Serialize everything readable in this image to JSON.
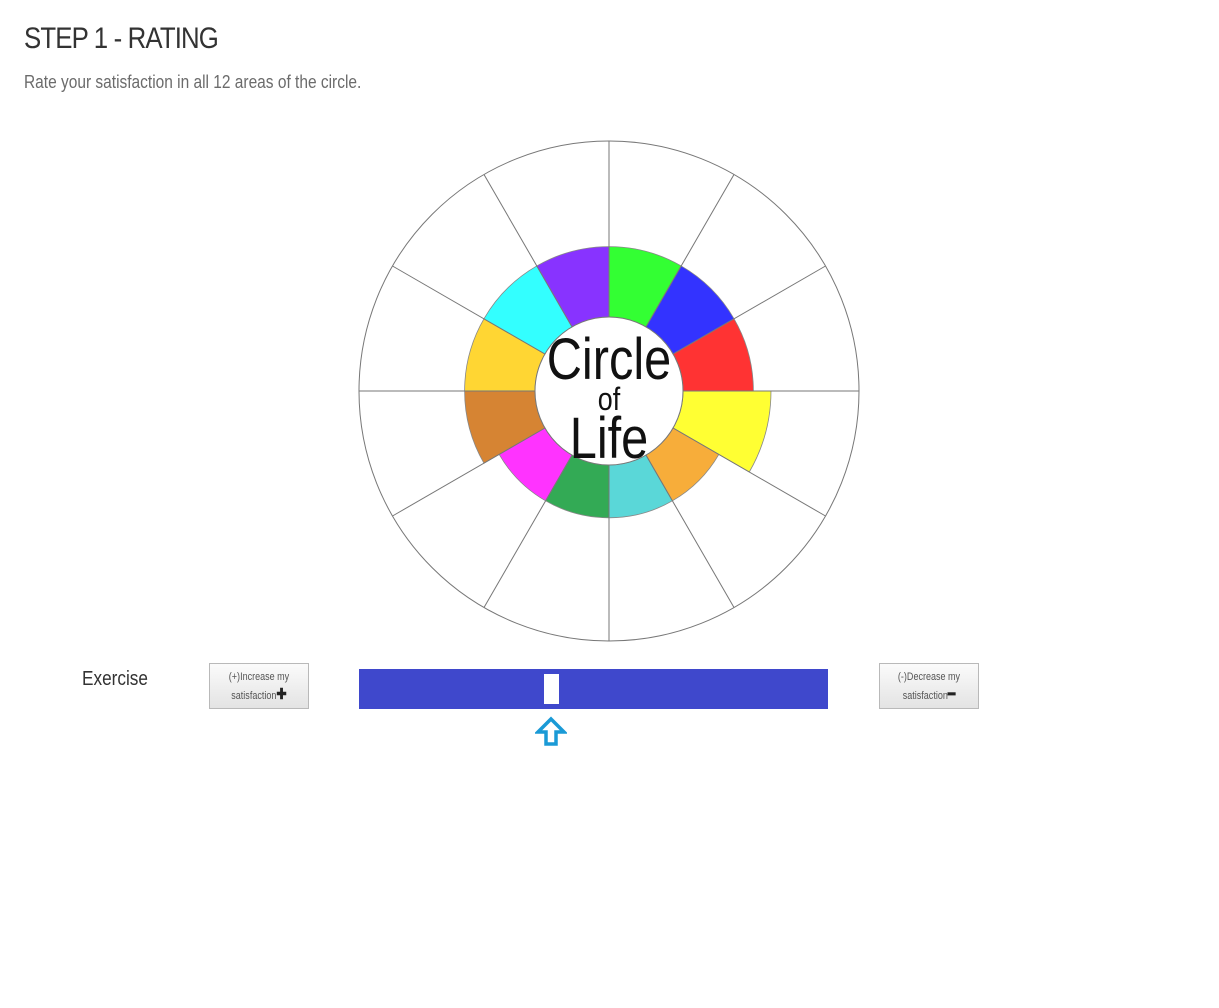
{
  "page": {
    "heading": "STEP 1 - RATING",
    "subheading": "Rate your satisfaction in all 12 areas of the circle."
  },
  "wheel": {
    "center_words": [
      "Circle",
      "of",
      "Life"
    ],
    "segments": [
      {
        "color": "#33ff33",
        "level": 4
      },
      {
        "color": "#3333ff",
        "level": 4
      },
      {
        "color": "#ff3333",
        "level": 4
      },
      {
        "color": "#ffff33",
        "level": 5
      },
      {
        "color": "#f7ad3a",
        "level": 3
      },
      {
        "color": "#5ad7d8",
        "level": 3
      },
      {
        "color": "#33aa55",
        "level": 3
      },
      {
        "color": "#ff33ff",
        "level": 3
      },
      {
        "color": "#d68433",
        "level": 4
      },
      {
        "color": "#ffd633",
        "level": 4
      },
      {
        "color": "#33ffff",
        "level": 4
      },
      {
        "color": "#8833ff",
        "level": 4
      }
    ],
    "max_level": 10
  },
  "rating": {
    "area_label": "Exercise",
    "increase_line1": "(+)Increase my",
    "increase_line2": "satisfaction",
    "increase_icon": "plus-icon",
    "decrease_line1": "(-)Decrease my",
    "decrease_line2": "satisfaction",
    "decrease_icon": "minus-icon",
    "slider_color": "#3f48cc",
    "slider_value_fraction": 0.41,
    "marker_color": "#1a9ad6",
    "marker_icon": "up-arrow-icon"
  }
}
